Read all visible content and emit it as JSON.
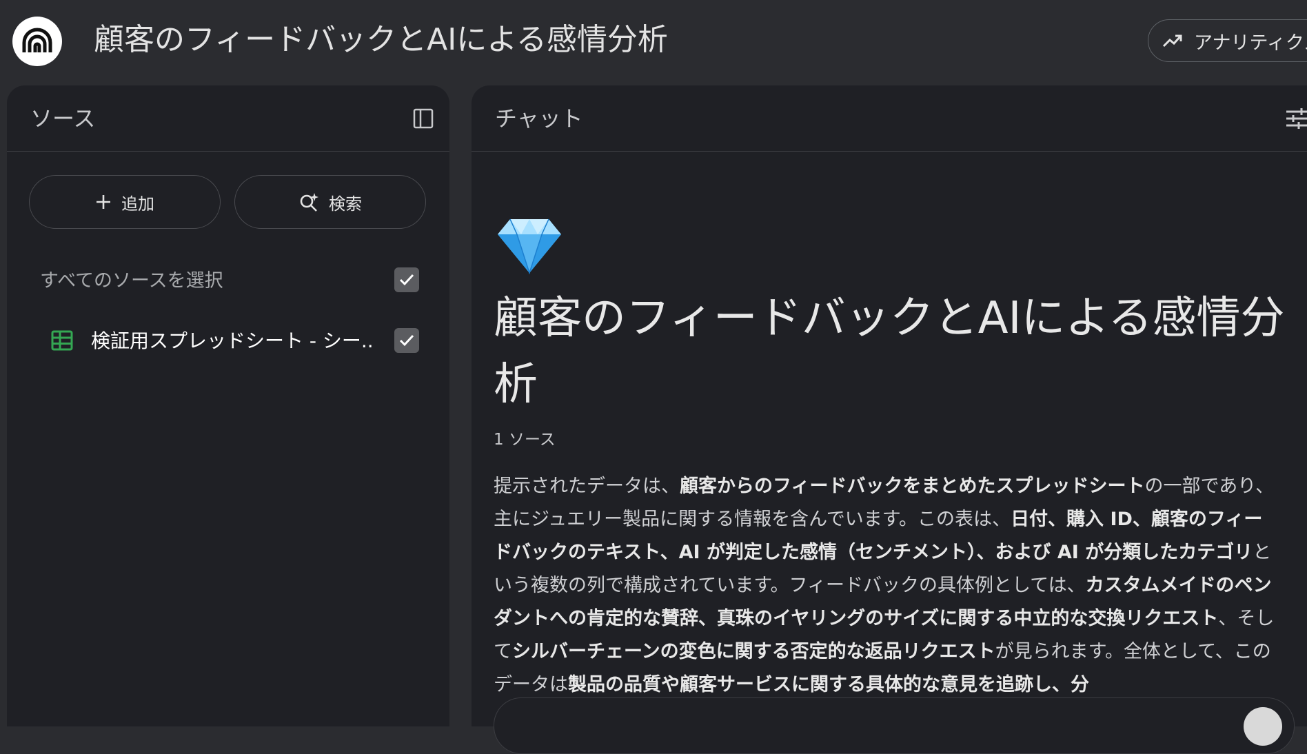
{
  "app": {
    "title": "顧客のフィードバックとAIによる感情分析",
    "logo_icon": "notebooklm-logo-icon",
    "analytics_label": "アナリティクス"
  },
  "sources": {
    "title": "ソース",
    "add_label": "追加",
    "search_label": "検索",
    "select_all_label": "すべてのソースを選択",
    "items": [
      {
        "name": "検証用スプレッドシート - シー...",
        "icon": "spreadsheet-icon",
        "checked": true
      }
    ]
  },
  "chat": {
    "title": "チャット",
    "emoji": "💎",
    "heading": "顧客のフィードバックとAIによる感情分析",
    "source_count": "1 ソース",
    "summary": [
      {
        "text": "提示されたデータは、",
        "bold": false
      },
      {
        "text": "顧客からのフィードバックをまとめたスプレッドシート",
        "bold": true
      },
      {
        "text": "の一部であり、主にジュエリー製品に関する情報を含んでいます。この表は、",
        "bold": false
      },
      {
        "text": "日付、購入 ID、顧客のフィードバックのテキスト、AI が判定した感情（センチメント）、および AI が分類したカテゴリ",
        "bold": true
      },
      {
        "text": "という複数の列で構成されています。フィードバックの具体例としては、",
        "bold": false
      },
      {
        "text": "カスタムメイドのペンダントへの肯定的な賛辞、真珠のイヤリングのサイズに関する中立的な交換リクエスト",
        "bold": true
      },
      {
        "text": "、そして",
        "bold": false
      },
      {
        "text": "シルバーチェーンの変色に関する否定的な返品リクエスト",
        "bold": true
      },
      {
        "text": "が見られます。全体として、このデータは",
        "bold": false
      },
      {
        "text": "製品の品質や顧客サービスに関する具体的な意見を追跡し、分",
        "bold": true
      }
    ]
  },
  "colors": {
    "background": "#2b2c30",
    "panel": "#1f2025",
    "sheet_green": "#34a853"
  }
}
